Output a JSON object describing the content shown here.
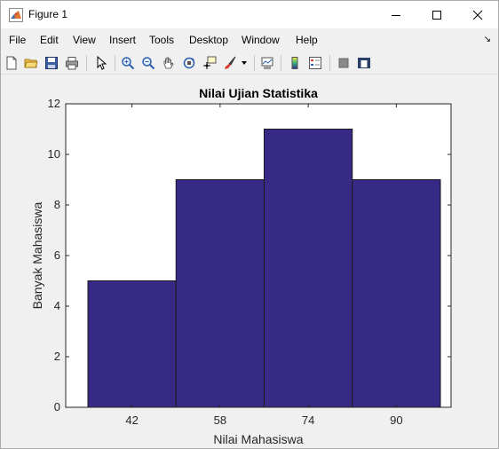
{
  "window": {
    "title": "Figure 1",
    "controls": [
      "minimize",
      "maximize",
      "close"
    ]
  },
  "menu": {
    "items": [
      "File",
      "Edit",
      "View",
      "Insert",
      "Tools",
      "Desktop",
      "Window",
      "Help"
    ]
  },
  "toolbar": {
    "buttons": [
      "new-figure-icon",
      "open-icon",
      "save-icon",
      "print-icon",
      "pointer-icon",
      "zoom-in-icon",
      "zoom-out-icon",
      "pan-icon",
      "rotate-3d-icon",
      "data-cursor-icon",
      "brush-icon",
      "link-plot-icon",
      "colorbar-icon",
      "legend-icon",
      "hide-plot-tools-icon",
      "show-plot-tools-icon"
    ]
  },
  "colors": {
    "bar_fill": "#362a86",
    "bar_edge": "#1a1a1a",
    "axes_bg": "#ffffff",
    "figure_bg": "#f0f0f0",
    "matlab_orange": "#e0752f"
  },
  "chart_data": {
    "type": "bar",
    "title": "Nilai Ujian Statistika",
    "xlabel": "Nilai Mahasiswa",
    "ylabel": "Banyak Mahasiswa",
    "categories": [
      "42",
      "58",
      "74",
      "90"
    ],
    "values": [
      5,
      9,
      11,
      9
    ],
    "ylim": [
      0,
      12
    ],
    "yticks": [
      0,
      2,
      4,
      6,
      8,
      10,
      12
    ],
    "grid": false,
    "legend": "none"
  }
}
